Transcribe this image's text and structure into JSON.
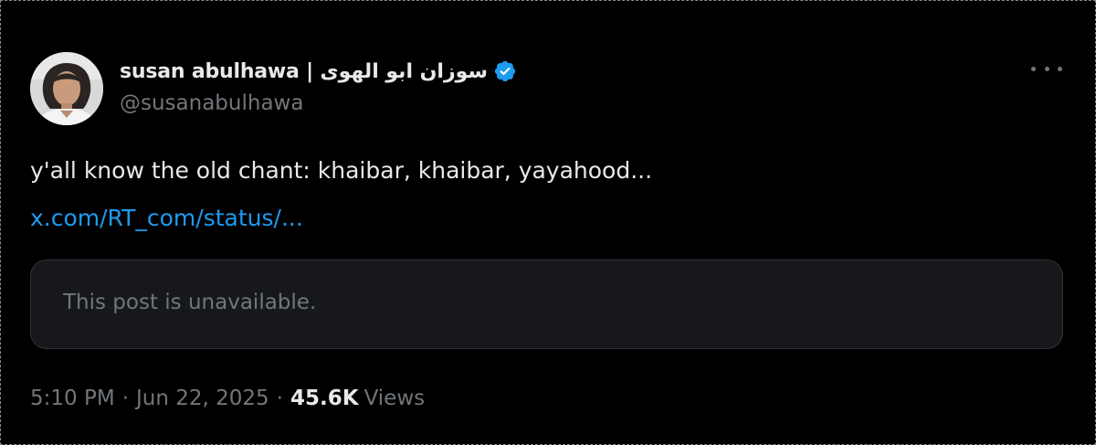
{
  "tweet": {
    "author": {
      "display_name": "susan abulhawa | سوزان ابو الهوى",
      "handle": "@susanabulhawa",
      "verified": true,
      "verified_color": "#1d9bf0"
    },
    "more_icon": "more-horizontal-icon",
    "text": "y'all know the old chant: khaibar, khaibar, yayahood...",
    "link": "x.com/RT_com/status/...",
    "quote": {
      "message": "This post is unavailable."
    },
    "meta": {
      "time": "5:10 PM",
      "separator": "·",
      "date": "Jun 22, 2025",
      "views_count": "45.6K",
      "views_label": "Views"
    }
  },
  "colors": {
    "background": "#000000",
    "text_primary": "#e7e9ea",
    "text_secondary": "#71767b",
    "link": "#1d9bf0",
    "card_bg": "#16181c",
    "card_border": "#2f3336"
  }
}
